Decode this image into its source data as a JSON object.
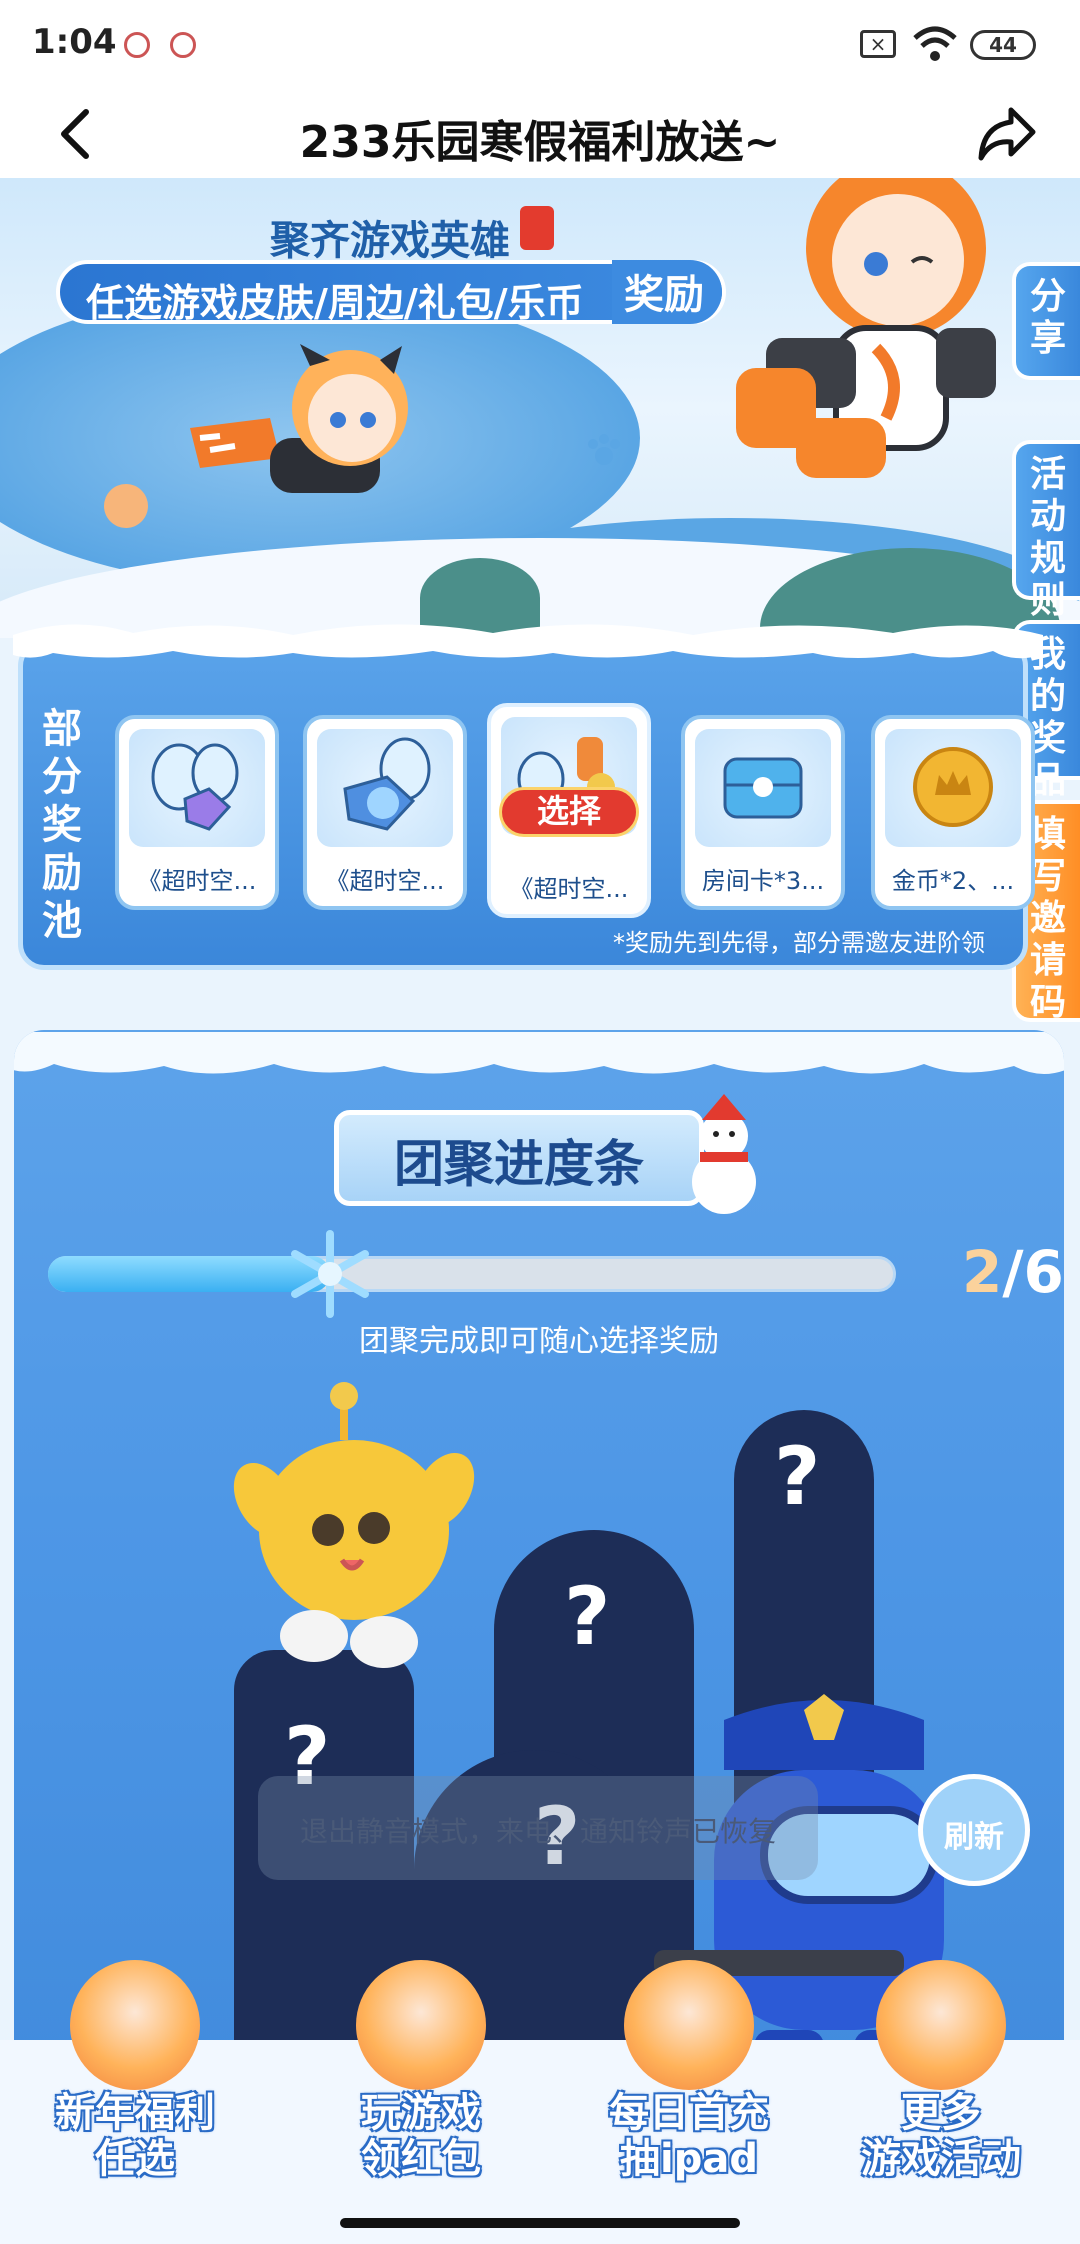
{
  "status_bar": {
    "time": "1:04",
    "battery": "44"
  },
  "header": {
    "title": "233乐园寒假福利放送~"
  },
  "hero": {
    "heading": "聚齐游戏英雄",
    "banner": "任选游戏皮肤/周边/礼包/乐币",
    "banner_tag": "奖励"
  },
  "side_tabs": [
    {
      "label": "分享"
    },
    {
      "label": "活动规则"
    },
    {
      "label": "我的奖品"
    },
    {
      "label": "填写邀请码"
    }
  ],
  "reward_pool": {
    "label": "部分奖励池",
    "items": [
      {
        "name": "《超时空..."
      },
      {
        "name": "《超时空..."
      },
      {
        "name": "《超时空..."
      },
      {
        "name": "房间卡*3..."
      },
      {
        "name": "金币*2、..."
      }
    ],
    "select_label": "选择",
    "note": "*奖励先到先得，部分需邀友进阶领"
  },
  "progress": {
    "title": "团聚进度条",
    "current": "2",
    "total": "/6",
    "fraction": 0.333,
    "hint": "团聚完成即可随心选择奖励"
  },
  "toast": "退出静音模式，来电、通知铃声已恢复",
  "refresh_label": "刷新",
  "question_mark": "?",
  "bottom_nav": [
    {
      "line1": "新年福利",
      "line2": "任选"
    },
    {
      "line1": "玩游戏",
      "line2": "领红包"
    },
    {
      "line1": "每日首充",
      "line2": "抽ipad"
    },
    {
      "line1": "更多",
      "line2": "游戏活动"
    }
  ],
  "colors": {
    "accent_blue": "#3b87da",
    "accent_orange": "#ff8e25",
    "badge_red": "#e23a2f"
  }
}
